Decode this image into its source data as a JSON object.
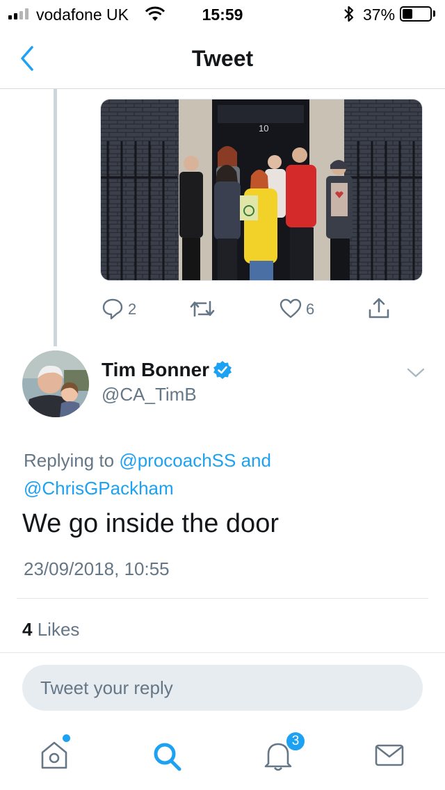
{
  "status_bar": {
    "carrier": "vodafone UK",
    "time": "15:59",
    "battery_percent_label": "37%",
    "battery_level": 0.37,
    "signal_bars": 2
  },
  "nav": {
    "title": "Tweet"
  },
  "previous_tweet": {
    "photo_sign": "10",
    "reply_count": "2",
    "like_count": "6"
  },
  "tweet": {
    "user_name": "Tim Bonner",
    "user_handle": "@CA_TimB",
    "replying_prefix": "Replying to",
    "reply_to_1": "@procoachSS",
    "reply_and": "and",
    "reply_to_2": "@ChrisGPackham",
    "text": "We go inside the door",
    "timestamp": "23/09/2018, 10:55",
    "likes_count": "4",
    "likes_label": "Likes"
  },
  "reply_box": {
    "placeholder": "Tweet your reply"
  },
  "tab_bar": {
    "notifications_badge": "3"
  },
  "colors": {
    "accent": "#1da1f2",
    "secondary_text": "#657786",
    "divider": "#e1e8ed",
    "input_bg": "#e6ecf0",
    "verified": "#1da1f2"
  }
}
